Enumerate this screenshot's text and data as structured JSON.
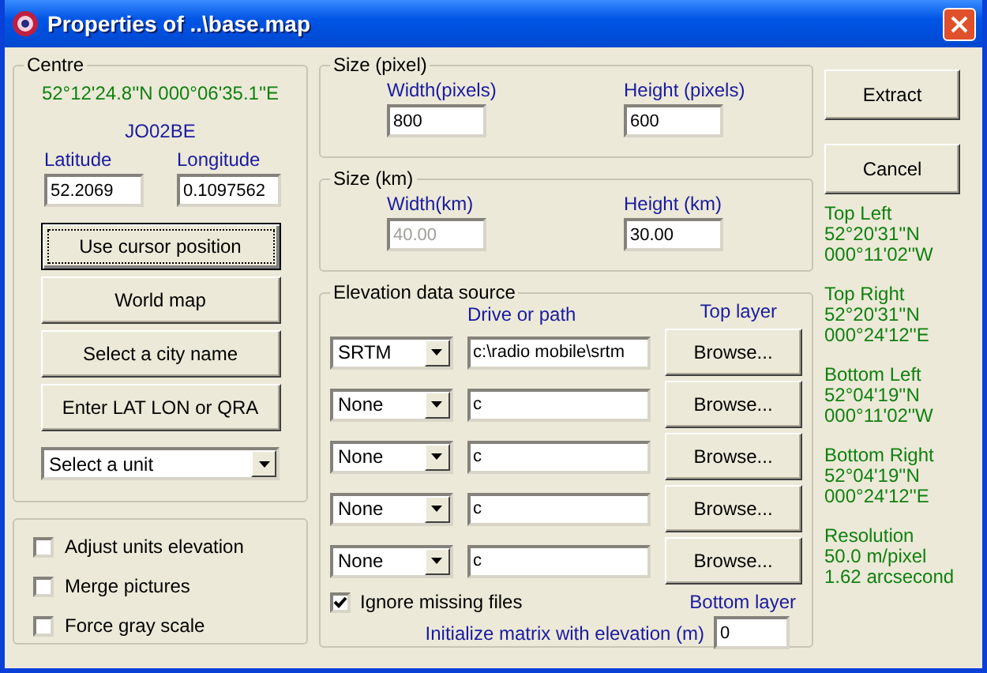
{
  "window": {
    "title": "Properties of ..\\base.map"
  },
  "centre": {
    "title": "Centre",
    "coordinates": "52°12'24.8''N 000°06'35.1''E",
    "locator": "JO02BE",
    "latitude": {
      "label": "Latitude",
      "value": "52.2069"
    },
    "longitude": {
      "label": "Longitude",
      "value": "0.1097562"
    },
    "buttons": [
      {
        "label": "Use cursor position",
        "focused": true
      },
      {
        "label": "World map",
        "focused": false
      },
      {
        "label": "Select a city name",
        "focused": false
      },
      {
        "label": "Enter LAT LON or QRA",
        "focused": false
      }
    ],
    "unit_select": {
      "value": "Select a unit"
    }
  },
  "options": [
    {
      "label": "Adjust units elevation",
      "checked": false
    },
    {
      "label": "Merge pictures",
      "checked": false
    },
    {
      "label": "Force gray scale",
      "checked": false
    }
  ],
  "size_pixel": {
    "title": "Size (pixel)",
    "width": {
      "label": "Width(pixels)",
      "value": "800",
      "disabled": false
    },
    "height": {
      "label": "Height (pixels)",
      "value": "600",
      "disabled": false
    }
  },
  "size_km": {
    "title": "Size (km)",
    "width": {
      "label": "Width(km)",
      "value": "40.00",
      "disabled": true
    },
    "height": {
      "label": "Height (km)",
      "value": "30.00",
      "disabled": false
    }
  },
  "elevation": {
    "title": "Elevation data source",
    "path_header": "Drive or path",
    "top_label": "Top layer",
    "bottom_label": "Bottom layer",
    "rows": [
      {
        "source": "SRTM",
        "path": "c:\\radio mobile\\srtm",
        "button": "Browse..."
      },
      {
        "source": "None",
        "path": "c",
        "button": "Browse..."
      },
      {
        "source": "None",
        "path": "c",
        "button": "Browse..."
      },
      {
        "source": "None",
        "path": "c",
        "button": "Browse..."
      },
      {
        "source": "None",
        "path": "c",
        "button": "Browse..."
      }
    ],
    "ignore_missing": {
      "label": "Ignore missing files",
      "checked": true
    },
    "init": {
      "label": "Initialize matrix with elevation (m)",
      "value": "0"
    }
  },
  "actions": [
    {
      "label": "Extract"
    },
    {
      "label": "Cancel"
    }
  ],
  "corners": [
    {
      "lines": [
        "Top Left",
        "52°20'31''N",
        "000°11'02''W"
      ]
    },
    {
      "lines": [
        "Top Right",
        "52°20'31''N",
        "000°24'12''E"
      ]
    },
    {
      "lines": [
        "Bottom Left",
        "52°04'19''N",
        "000°11'02''W"
      ]
    },
    {
      "lines": [
        "Bottom Right",
        "52°04'19''N",
        "000°24'12''E"
      ]
    },
    {
      "lines": [
        "Resolution",
        "50.0 m/pixel",
        "1.62 arcsecond"
      ]
    }
  ]
}
